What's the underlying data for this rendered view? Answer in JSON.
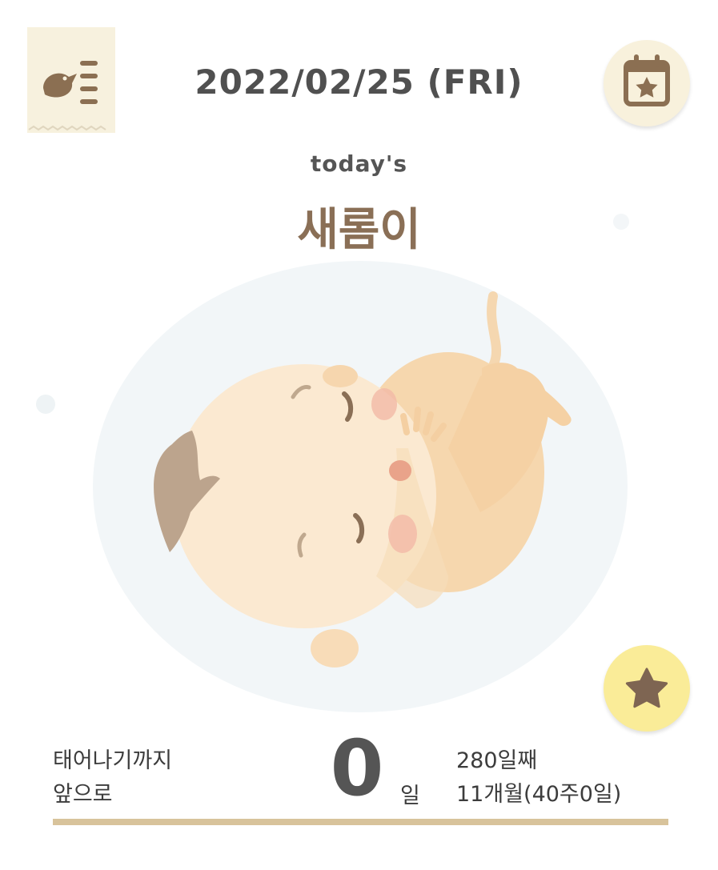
{
  "header": {
    "date": "2022/02/25 (FRI)"
  },
  "main": {
    "todays_label": "today's",
    "baby_name": "새롬이"
  },
  "countdown": {
    "label_line1": "태어나기까지",
    "label_line2": "앞으로",
    "days_remaining": "0",
    "days_unit": "일",
    "day_count": "280일째",
    "month_week": "11개월(40주0일)",
    "progress_fraction": 1.0
  },
  "colors": {
    "accent_brown": "#8a6f56",
    "calendar_bg": "#f8f1dc",
    "favorite_bg": "#faec98",
    "progress": "#d8c39b"
  },
  "icons": {
    "menu": "bird-list-icon",
    "calendar": "calendar-star-icon",
    "favorite": "star-icon"
  }
}
